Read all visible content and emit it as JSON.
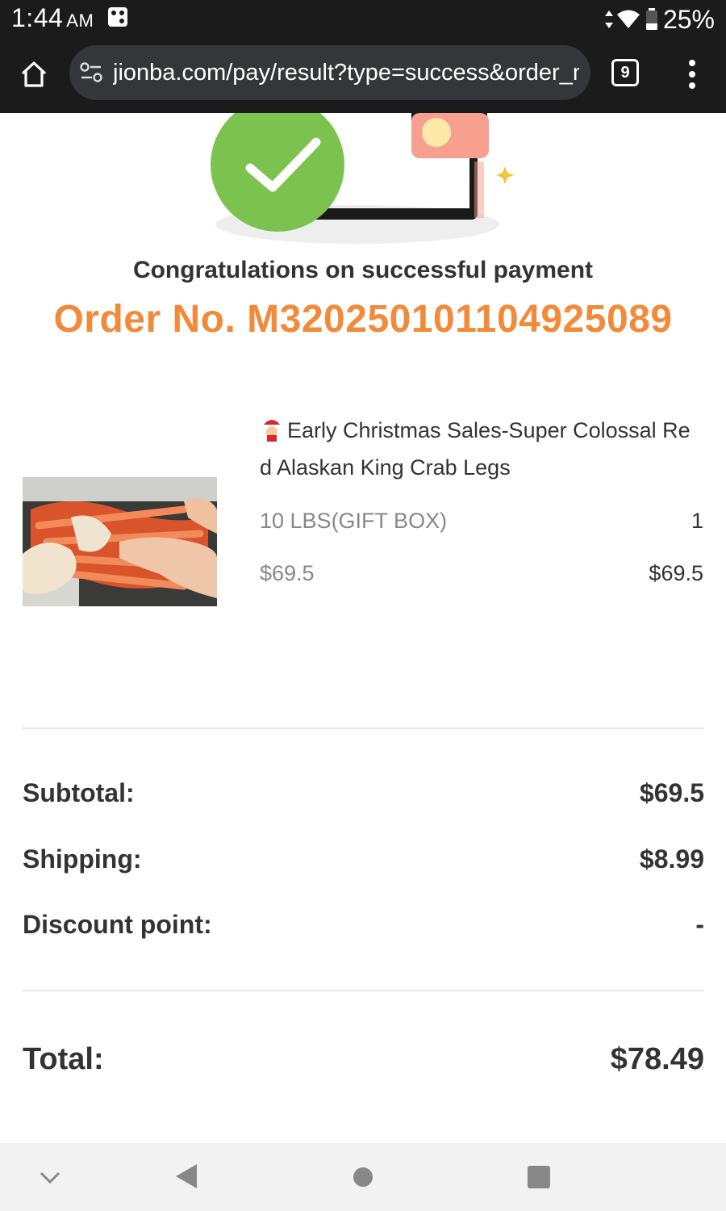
{
  "status_bar": {
    "time": "1:44",
    "ampm": "AM",
    "battery": "25%"
  },
  "browser": {
    "url": "jionba.com/pay/result?type=success&order_n",
    "tab_count": "9"
  },
  "result": {
    "title": "Congratulations on successful payment",
    "order_no": "Order No. M3202501011049250​89"
  },
  "product": {
    "title": "Early Christmas Sales-Super Colossal Red Alaskan King Crab Legs",
    "variant": "10 LBS(GIFT BOX)",
    "quantity": "1",
    "unit_price": "$69.5",
    "line_total": "$69.5"
  },
  "summary": {
    "subtotal_label": "Subtotal:",
    "subtotal_value": "$69.5",
    "shipping_label": "Shipping:",
    "shipping_value": "$8.99",
    "discount_label": "Discount point:",
    "discount_value": "-",
    "total_label": "Total:",
    "total_value": "$78.49"
  },
  "colors": {
    "accent_orange": "#f28a3a",
    "success_green": "#7bc24f",
    "card_pink": "#f7a08f"
  }
}
